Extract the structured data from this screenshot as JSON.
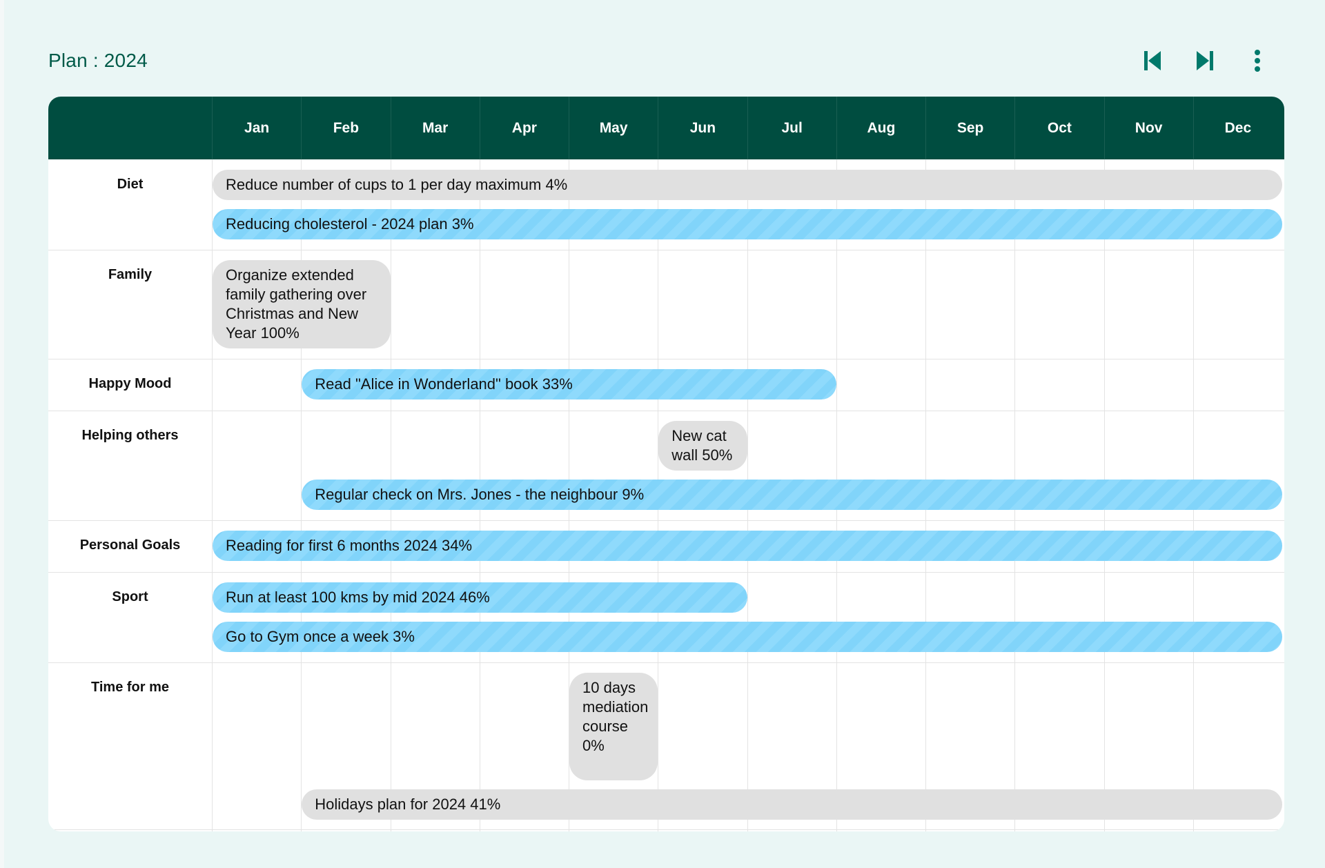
{
  "title": "Plan : 2024",
  "toolbar": {
    "prev_icon": "skip-previous-icon",
    "next_icon": "skip-next-icon",
    "more_icon": "more-vertical-icon",
    "accent": "#00796b"
  },
  "colors": {
    "header": "#004d40",
    "background": "#eaf6f5",
    "gray_bar": "#e0e0e0",
    "blue_bar": "#81d4fa"
  },
  "months": [
    "Jan",
    "Feb",
    "Mar",
    "Apr",
    "May",
    "Jun",
    "Jul",
    "Aug",
    "Sep",
    "Oct",
    "Nov",
    "Dec"
  ],
  "categories": [
    {
      "label": "Diet"
    },
    {
      "label": "Family"
    },
    {
      "label": "Happy Mood"
    },
    {
      "label": "Helping others"
    },
    {
      "label": "Personal Goals"
    },
    {
      "label": "Sport"
    },
    {
      "label": "Time for me"
    }
  ],
  "tasks": [
    {
      "category": "Diet",
      "text": "Reduce number of cups to 1 per day maximum 4%",
      "start_month": "Jan",
      "end_month": "Dec",
      "progress": 4,
      "style": "gray"
    },
    {
      "category": "Diet",
      "text": "Reducing cholesterol - 2024 plan 3%",
      "start_month": "Jan",
      "end_month": "Dec",
      "progress": 3,
      "style": "blue"
    },
    {
      "category": "Family",
      "text": "Organize extended family gathering over Christmas and New Year 100%",
      "start_month": "Jan",
      "end_month": "Feb",
      "progress": 100,
      "style": "gray"
    },
    {
      "category": "Happy Mood",
      "text": "Read \"Alice in Wonderland\" book 33%",
      "start_month": "Feb",
      "end_month": "Jul",
      "progress": 33,
      "style": "blue"
    },
    {
      "category": "Helping others",
      "text": "New cat wall 50%",
      "start_month": "Jun",
      "end_month": "Jun",
      "progress": 50,
      "style": "gray"
    },
    {
      "category": "Helping others",
      "text": "Regular check on Mrs. Jones - the neighbour 9%",
      "start_month": "Feb",
      "end_month": "Dec",
      "progress": 9,
      "style": "blue"
    },
    {
      "category": "Personal Goals",
      "text": "Reading for first 6 months 2024 34%",
      "start_month": "Jan",
      "end_month": "Dec",
      "progress": 34,
      "style": "blue"
    },
    {
      "category": "Sport",
      "text": "Run at least 100 kms by mid 2024 46%",
      "start_month": "Jan",
      "end_month": "Jun",
      "progress": 46,
      "style": "blue"
    },
    {
      "category": "Sport",
      "text": "Go to Gym once a week 3%",
      "start_month": "Jan",
      "end_month": "Dec",
      "progress": 3,
      "style": "blue"
    },
    {
      "category": "Time for me",
      "text": "10 days mediation course 0%",
      "start_month": "May",
      "end_month": "May",
      "progress": 0,
      "style": "gray"
    },
    {
      "category": "Time for me",
      "text": "Holidays plan for 2024 41%",
      "start_month": "Feb",
      "end_month": "Dec",
      "progress": 41,
      "style": "gray"
    }
  ]
}
